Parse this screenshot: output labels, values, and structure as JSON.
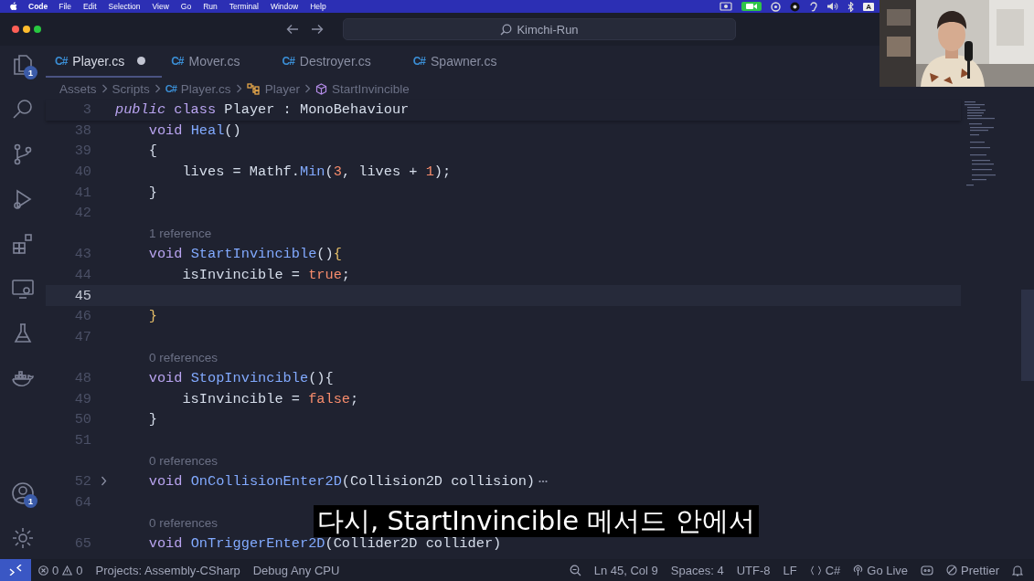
{
  "menu_bar": {
    "app_name": "Code",
    "items": [
      "File",
      "Edit",
      "Selection",
      "View",
      "Go",
      "Run",
      "Terminal",
      "Window",
      "Help"
    ],
    "input_source": "A"
  },
  "title_bar": {
    "search": "Kimchi-Run"
  },
  "activity_bar": {
    "top": [
      {
        "kind": "files",
        "badge": "1"
      },
      {
        "kind": "search"
      },
      {
        "kind": "branch"
      },
      {
        "kind": "run"
      },
      {
        "kind": "blocks"
      },
      {
        "kind": "monitor"
      },
      {
        "kind": "flask"
      },
      {
        "kind": "whale"
      }
    ],
    "bottom": [
      {
        "kind": "account",
        "badge": "1"
      },
      {
        "kind": "gear"
      }
    ]
  },
  "tabs": [
    {
      "label": "Player.cs",
      "file_icon": "C#",
      "selected": true,
      "modified": true
    },
    {
      "label": "Mover.cs",
      "file_icon": "C#",
      "selected": false,
      "modified": false
    },
    {
      "label": "Destroyer.cs",
      "file_icon": "C#",
      "selected": false,
      "modified": false
    },
    {
      "label": "Spawner.cs",
      "file_icon": "C#",
      "selected": false,
      "modified": false
    }
  ],
  "breadcrumbs": [
    {
      "label": "Assets",
      "kind": "folder"
    },
    {
      "label": "Scripts",
      "kind": "folder"
    },
    {
      "label": "Player.cs",
      "kind": "csharp",
      "file_icon": "C#"
    },
    {
      "label": "Player",
      "kind": "class"
    },
    {
      "label": "StartInvincible",
      "kind": "method"
    }
  ],
  "editor": {
    "sticky": {
      "number": "3",
      "tokens": [
        {
          "text": "public",
          "kind": "modifier"
        },
        {
          "text": " class ",
          "kind": "keyword"
        },
        {
          "text": "Player : MonoBehaviour",
          "kind": "plain"
        }
      ]
    },
    "lines": [
      {
        "kind": "code",
        "number": "38",
        "current": false,
        "folded": false,
        "tokens": [
          {
            "text": "    void ",
            "kind": "keyword"
          },
          {
            "text": "Heal",
            "kind": "function"
          },
          {
            "text": "()",
            "kind": "plain"
          }
        ]
      },
      {
        "kind": "code",
        "number": "39",
        "current": false,
        "folded": false,
        "tokens": [
          {
            "text": "    {",
            "kind": "plain"
          }
        ]
      },
      {
        "kind": "code",
        "number": "40",
        "current": false,
        "folded": false,
        "tokens": [
          {
            "text": "        lives = Mathf.",
            "kind": "plain"
          },
          {
            "text": "Min",
            "kind": "function"
          },
          {
            "text": "(",
            "kind": "plain"
          },
          {
            "text": "3",
            "kind": "number"
          },
          {
            "text": ", lives + ",
            "kind": "plain"
          },
          {
            "text": "1",
            "kind": "number"
          },
          {
            "text": ");",
            "kind": "plain"
          }
        ]
      },
      {
        "kind": "code",
        "number": "41",
        "current": false,
        "folded": false,
        "tokens": [
          {
            "text": "    }",
            "kind": "plain"
          }
        ]
      },
      {
        "kind": "code",
        "number": "42",
        "current": false,
        "folded": false
      },
      {
        "kind": "codelens",
        "text": "1 reference"
      },
      {
        "kind": "code",
        "number": "43",
        "current": false,
        "folded": false,
        "tokens": [
          {
            "text": "    void ",
            "kind": "keyword"
          },
          {
            "text": "StartInvincible",
            "kind": "function"
          },
          {
            "text": "()",
            "kind": "plain"
          },
          {
            "text": "{",
            "kind": "match"
          }
        ]
      },
      {
        "kind": "code",
        "number": "44",
        "current": false,
        "folded": false,
        "tokens": [
          {
            "text": "        isInvincible = ",
            "kind": "plain"
          },
          {
            "text": "true",
            "kind": "number"
          },
          {
            "text": ";",
            "kind": "plain"
          }
        ]
      },
      {
        "kind": "code",
        "number": "45",
        "current": true,
        "folded": false
      },
      {
        "kind": "code",
        "number": "46",
        "current": false,
        "folded": false,
        "tokens": [
          {
            "text": "    }",
            "kind": "match"
          }
        ]
      },
      {
        "kind": "code",
        "number": "47",
        "current": false,
        "folded": false
      },
      {
        "kind": "codelens",
        "text": "0 references"
      },
      {
        "kind": "code",
        "number": "48",
        "current": false,
        "folded": false,
        "tokens": [
          {
            "text": "    void ",
            "kind": "keyword"
          },
          {
            "text": "StopInvincible",
            "kind": "function"
          },
          {
            "text": "(){",
            "kind": "plain"
          }
        ]
      },
      {
        "kind": "code",
        "number": "49",
        "current": false,
        "folded": false,
        "tokens": [
          {
            "text": "        isInvincible = ",
            "kind": "plain"
          },
          {
            "text": "false",
            "kind": "number"
          },
          {
            "text": ";",
            "kind": "plain"
          }
        ]
      },
      {
        "kind": "code",
        "number": "50",
        "current": false,
        "folded": false,
        "tokens": [
          {
            "text": "    }",
            "kind": "plain"
          }
        ]
      },
      {
        "kind": "code",
        "number": "51",
        "current": false,
        "folded": false
      },
      {
        "kind": "codelens",
        "text": "0 references"
      },
      {
        "kind": "code",
        "number": "52",
        "current": false,
        "folded": true,
        "tokens": [
          {
            "text": "    void ",
            "kind": "keyword"
          },
          {
            "text": "OnCollisionEnter2D",
            "kind": "function"
          },
          {
            "text": "(Collision2D collision)",
            "kind": "plain"
          }
        ]
      },
      {
        "kind": "code",
        "number": "64",
        "current": false,
        "folded": false
      },
      {
        "kind": "codelens",
        "text": "0 references"
      },
      {
        "kind": "code",
        "number": "65",
        "current": false,
        "folded": false,
        "tokens": [
          {
            "text": "    void ",
            "kind": "keyword"
          },
          {
            "text": "OnTriggerEnter2D",
            "kind": "function"
          },
          {
            "text": "(Collider2D collider)",
            "kind": "plain"
          }
        ]
      }
    ]
  },
  "subtitle": "다시, StartInvincible 메서드 안에서",
  "status_bar": {
    "errors": "0",
    "warnings": "0",
    "left": [
      "Projects: Assembly-CSharp",
      "Debug Any CPU"
    ],
    "right": [
      {
        "kind": "zoom"
      },
      {
        "text": "Ln 45, Col 9"
      },
      {
        "text": "Spaces: 4"
      },
      {
        "text": "UTF-8"
      },
      {
        "text": "LF"
      },
      {
        "kind": "braces",
        "text": "C#"
      },
      {
        "kind": "broadcast",
        "text": "Go Live"
      },
      {
        "kind": "copilot"
      },
      {
        "kind": "no",
        "text": "Prettier"
      },
      {
        "kind": "bell"
      }
    ]
  }
}
